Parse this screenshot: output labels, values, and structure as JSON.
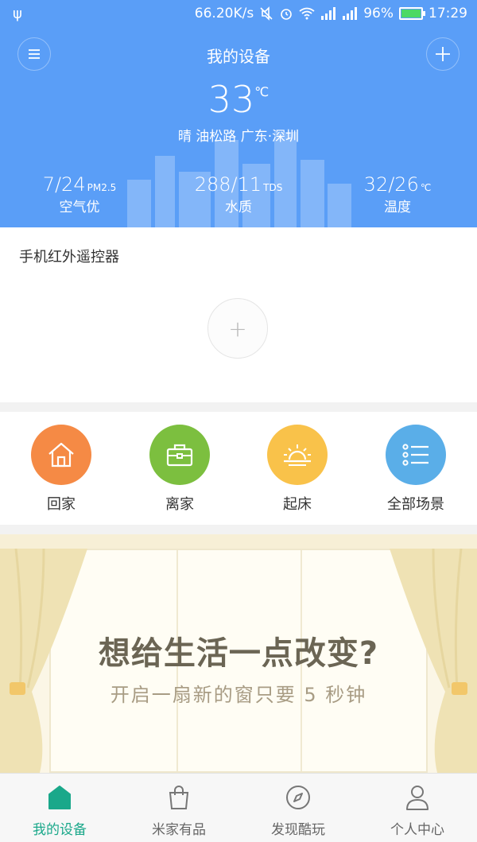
{
  "status_bar": {
    "speed": "66.20K/s",
    "battery": "96%",
    "time": "17:29"
  },
  "header": {
    "title": "我的设备",
    "temperature": "33",
    "temperature_unit": "℃",
    "location": "晴  油松路 广东·深圳",
    "stats": [
      {
        "value": "7/24",
        "unit": "PM2.5",
        "label": "空气优"
      },
      {
        "value": "288/11",
        "unit": "TDS",
        "label": "水质"
      },
      {
        "value": "32/26",
        "unit": "℃",
        "label": "温度"
      }
    ]
  },
  "ir_card": {
    "label": "手机红外遥控器",
    "add_symbol": "+"
  },
  "scenes": [
    {
      "name": "回家",
      "color": "#f58a45",
      "icon": "home-icon"
    },
    {
      "name": "离家",
      "color": "#7cbf3f",
      "icon": "briefcase-icon"
    },
    {
      "name": "起床",
      "color": "#f9c24a",
      "icon": "sunrise-icon"
    },
    {
      "name": "全部场景",
      "color": "#5aaee8",
      "icon": "list-icon"
    }
  ],
  "banner": {
    "title": "想给生活一点改变?",
    "subtitle": "开启一扇新的窗只要 5 秒钟"
  },
  "bottom_nav": [
    {
      "label": "我的设备",
      "icon": "home-filled-icon",
      "active": true
    },
    {
      "label": "米家有品",
      "icon": "shopping-bag-icon",
      "active": false
    },
    {
      "label": "发现酷玩",
      "icon": "compass-icon",
      "active": false
    },
    {
      "label": "个人中心",
      "icon": "person-icon",
      "active": false
    }
  ],
  "colors": {
    "header_bg": "#5a9ef7",
    "active_tab": "#1aa88a"
  }
}
